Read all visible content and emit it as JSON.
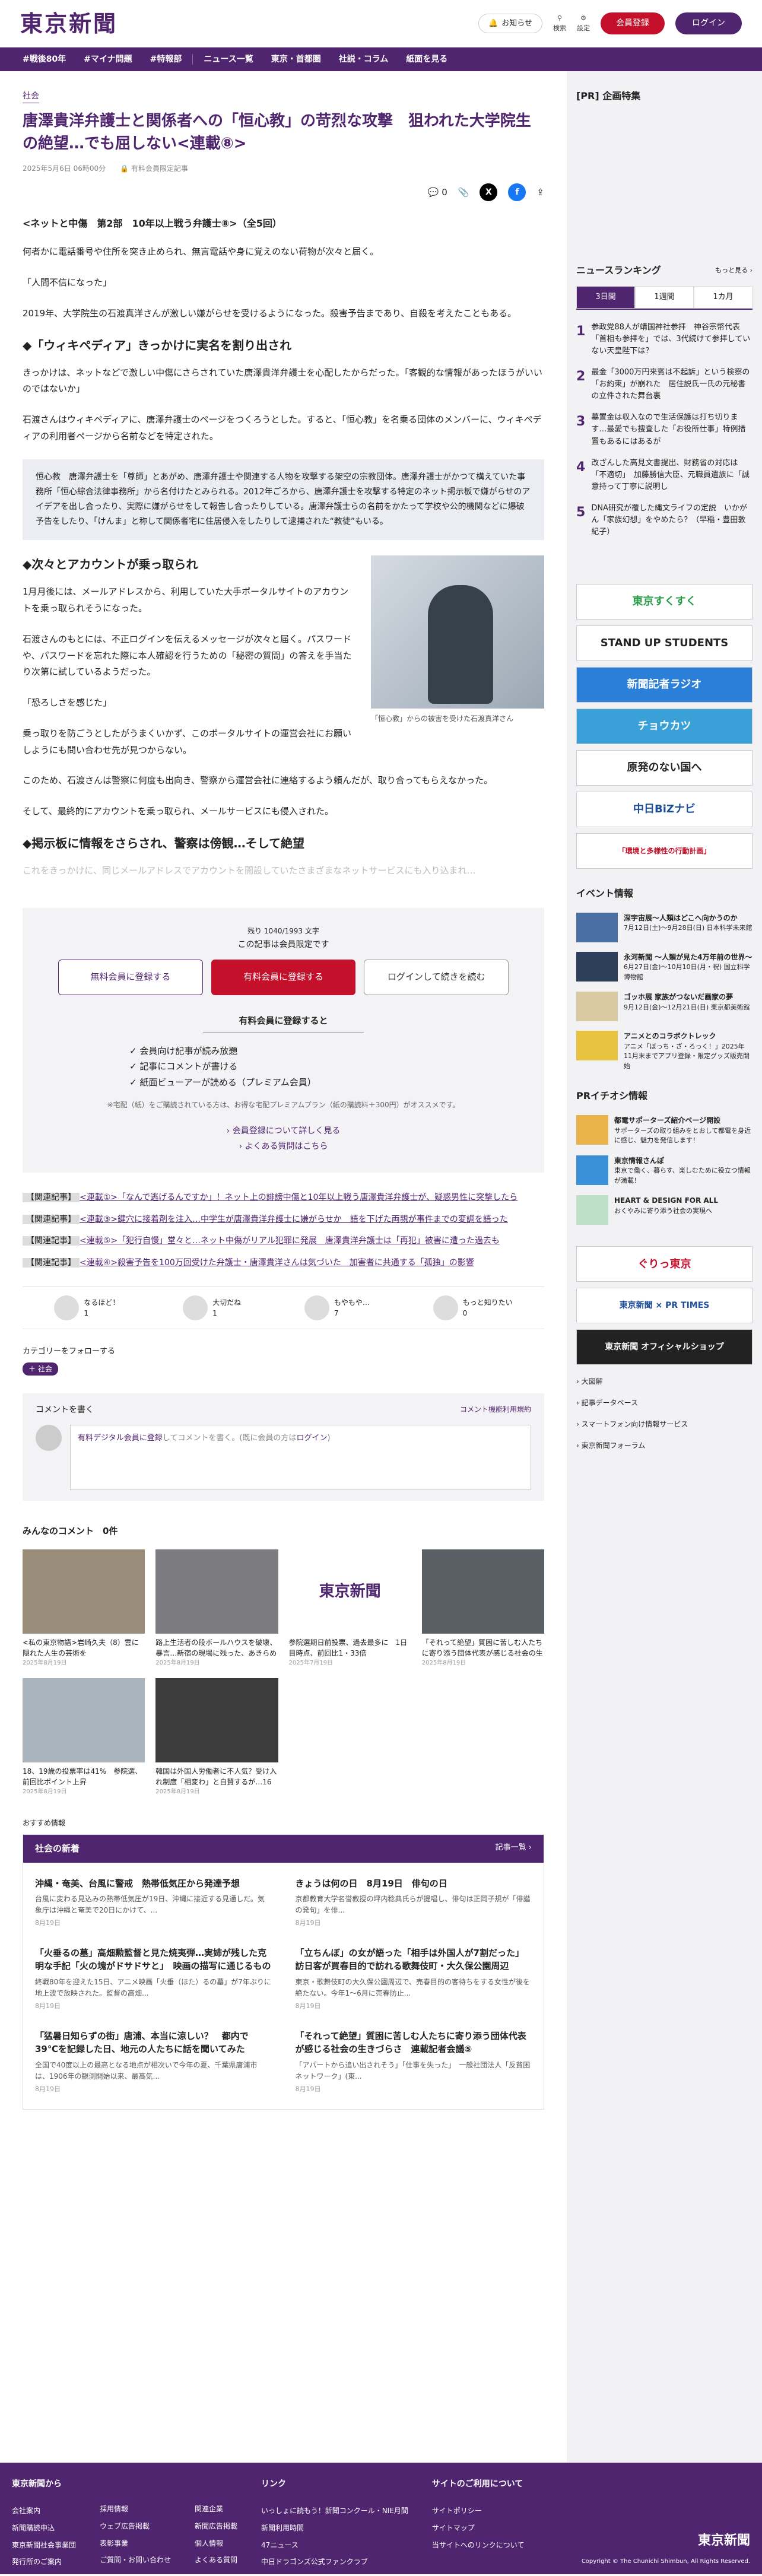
{
  "header": {
    "logo": "東京新聞",
    "notice": "お知らせ",
    "search": "検索",
    "settings": "設定",
    "register": "会員登録",
    "login": "ログイン"
  },
  "nav": {
    "items": [
      "#戦後80年",
      "#マイナ問題",
      "#特報部",
      "ニュース一覧",
      "東京・首都圏",
      "社説・コラム",
      "紙面を見る"
    ]
  },
  "article": {
    "category": "社会",
    "title": "唐澤貴洋弁護士と関係者への「恒心教」の苛烈な攻撃　狙われた大学院生の絶望…でも屈しない<連載⑧>",
    "date": "2025年5月6日 06時00分",
    "badge": "有料会員限定記事",
    "comment_count": "0",
    "series": "<ネットと中傷　第2部　10年以上戦う弁護士⑧>（全5回）",
    "paras": [
      "何者かに電話番号や住所を突き止められ、無言電話や身に覚えのない荷物が次々と届く。",
      "「人間不信になった」",
      "2019年、大学院生の石渡真洋さんが激しい嫌がらせを受けるようになった。殺害予告まであり、自殺を考えたこともある。"
    ],
    "h1": "◆「ウィキペディア」きっかけに実名を割り出され",
    "paras2": [
      "きっかけは、ネットなどで激しい中傷にさらされていた唐澤貴洋弁護士を心配したからだった。「客観的な情報があったほうがいいのではないか」",
      "石渡さんはウィキペディアに、唐澤弁護士のページをつくろうとした。すると、「恒心教」を名乗る団体のメンバーに、ウィキペディアの利用者ページから名前などを特定された。"
    ],
    "note": "恒心教　唐澤弁護士を「尊師」とあがめ、唐澤弁護士や関連する人物を攻撃する架空の宗教団体。唐澤弁護士がかつて構えていた事務所「恒心綜合法律事務所」から名付けたとみられる。2012年ごろから、唐澤弁護士を攻撃する特定のネット掲示板で嫌がらせのアイデアを出し合ったり、実際に嫌がらせをして報告し合ったりしている。唐澤弁護士らの名前をかたって学校や公的機関などに爆破予告をしたり、「けんま」と称して関係者宅に住居侵入をしたりして逮捕された“教徒”もいる。",
    "h2": "◆次々とアカウントが乗っ取られ",
    "paras3": [
      "1月月後には、メールアドレスから、利用していた大手ポータルサイトのアカウントを乗っ取られそうになった。",
      "石渡さんのもとには、不正ログインを伝えるメッセージが次々と届く。パスワードや、パスワードを忘れた際に本人確認を行うための「秘密の質問」の答えを手当たり次第に試しているようだった。",
      "「恐ろしさを感じた」",
      "乗っ取りを防ごうとしたがうまくいかず、このポータルサイトの運営会社にお願いしようにも問い合わせ先が見つからない。",
      "このため、石渡さんは警察に何度も出向き、警察から運営会社に連絡するよう頼んだが、取り合ってもらえなかった。",
      "そして、最終的にアカウントを乗っ取られ、メールサービスにも侵入された。"
    ],
    "caption": "「恒心教」からの被害を受けた石渡真洋さん",
    "h3": "◆掲示板に情報をさらされ、警察は傍観…そして絶望",
    "fade": "これをきっかけに、同じメールアドレスでアカウントを開設していたさまざまなネットサービスにも入り込まれ…"
  },
  "paywall": {
    "count": "残り 1040/1993 文字",
    "title": "この記事は会員限定です",
    "b1": "無料会員に登録する",
    "b2": "有料会員に登録する",
    "b3": "ログインして続きを読む",
    "head": "有料会員に登録すると",
    "list": [
      "✓ 会員向け記事が読み放題",
      "✓ 記事にコメントが書ける",
      "✓ 紙面ビューアーが読める（プレミアム会員）"
    ],
    "small": "※宅配（紙）をご購読されている方は、お得な宅配プレミアムプラン（紙の購読料＋300円）がオススメです。",
    "l1": "› 会員登録について詳しく見る",
    "l2": "› よくある質問はこちら"
  },
  "related": [
    {
      "tag": "【関連記事】",
      "text": "<連載①>「なんで逃げるんですか」！ネット上の誹謗中傷と10年以上戦う唐澤貴洋弁護士が、疑惑男性に突撃したら"
    },
    {
      "tag": "【関連記事】",
      "text": "<連載③>鍵穴に接着剤を注入…中学生が唐澤貴洋弁護士に嫌がらせか　語を下げた両親が事件までの変調を語った"
    },
    {
      "tag": "【関連記事】",
      "text": "<連載⑤>「犯行自慢」堂々と…ネット中傷がリアル犯罪に発展　唐澤貴洋弁護士は「再犯」被害に遭った過去も"
    },
    {
      "tag": "【関連記事】",
      "text": "<連載④>殺害予告を100万回受けた弁護士・唐澤貴洋さんは気づいた　加害者に共通する「孤独」の影響"
    }
  ],
  "reactions": [
    {
      "label": "なるほど！",
      "count": "1"
    },
    {
      "label": "大切だね",
      "count": "1"
    },
    {
      "label": "もやもや…",
      "count": "7"
    },
    {
      "label": "もっと知りたい",
      "count": "0"
    }
  ],
  "follow": {
    "label": "カテゴリーをフォローする",
    "tag": "＋ 社会"
  },
  "comment": {
    "title": "コメントを書く",
    "link": "コメント機能利用規約",
    "pre": "有料デジタル会員に登録",
    "mid": "してコメントを書く。(既に会員の方は",
    "login": "ログイン",
    "post": ")"
  },
  "all_comments": "みんなのコメント　0件",
  "cards": [
    {
      "t": "<私の東京物語>岩崎久夫（8）雲に隠れた人生の芸術を",
      "d": "2025年8月19日"
    },
    {
      "t": "路上生活者の段ボールハウスを破壊、暴言…新宿の現場に残った、あきらめの声「やり...",
      "d": "2025年8月19日"
    },
    {
      "t": "参院選期日前投票、過去最多に　1日目時点、前回比1・33倍",
      "d": "2025年7月19日"
    },
    {
      "t": "「それって絶望」質困に苦しむ人たちに寄り添う団体代表が感じる社会の生きづらさ　連載...",
      "d": "2025年8月19日"
    },
    {
      "t": "18、19歳の投票率は41%　参院選、前回比ポイント上昇",
      "d": "2025年8月19日"
    },
    {
      "t": "韓国は外国人労働者に不人気？受け入れ制度「相変わ」と自賛するが…16万5000人の仲介手...",
      "d": "2025年8月19日"
    }
  ],
  "recommend": "おすすめ情報",
  "news": {
    "title": "社会の新着",
    "more": "記事一覧 ›",
    "items": [
      {
        "t": "沖縄・奄美、台風に警戒　熱帯低気圧から発達予想",
        "s": "台風に変わる見込みの熱帯低気圧が19日、沖縄に接近する見通しだ。気象庁は沖縄と奄美で20日にかけて、...",
        "d": "8月19日"
      },
      {
        "t": "きょうは何の日　8月19日　俳句の日",
        "s": "京都教育大学名誉教授の坪内稔典氏らが提唱し、俳句は正岡子規が「俳諧の発句」を俳...",
        "d": "8月19日"
      },
      {
        "t": "「火垂るの墓」高畑勲監督と見た焼夷弾…実姉が残した克明な手記「火の塊がドサドサと」　映画の描写に通じるもの",
        "s": "終戦80年を迎えた15日、アニメ映画「火垂（ほた）るの墓」が7年ぶりに地上波で放映された。監督の高畑...",
        "d": "8月19日"
      },
      {
        "t": "「立ちんぼ」の女が語った「相手は外国人が7割だった」訪日客が買春目的で訪れる歌舞伎町・大久保公園周辺",
        "s": "東京・歌舞伎町の大久保公園周辺で、売春目的の客待ちをする女性が後を絶たない。今年1〜6月に売春防止...",
        "d": "8月19日"
      },
      {
        "t": "「猛暑日知らずの街」唐浦、本当に涼しい？　都内で39℃を記録した日、地元の人たちに話を聞いてみた",
        "s": "全国で40度以上の最高となる地点が相次いで今年の夏、千葉県唐浦市は、1906年の観測開始以来、最高気...",
        "d": "8月19日"
      },
      {
        "t": "「それって絶望」質困に苦しむ人たちに寄り添う団体代表が感じる社会の生きづらさ　連載記者会議⑤",
        "s": "「アパートから追い出されそう」「仕事を失った」　一般社団法人「反貧困ネットワーク」(東...",
        "d": "8月19日"
      }
    ]
  },
  "side": {
    "pr": "[PR] 企画特集",
    "ranking": "ニュースランキング",
    "more": "もっと見る ›",
    "tabs": [
      "3日間",
      "1週間",
      "1カ月"
    ],
    "ranks": [
      "参政党88人が靖国神社参拝　神谷宗幣代表「首相も参拝を」では、3代続けて参拝していない天皇陛下は？",
      "最金「3000万円来賓は不起訴」という検察の「お約束」が崩れた　居住説氏一氏の元秘書の立件された舞台裏",
      "墓置金は収入なので生活保護は打ち切ります…最愛でも捜査した「お役所仕事」特例措置もあるにはあるが",
      "改ざんした高見文書提出、財務省の対応は「不適切」　加藤勝信大臣、元職員遺族に「誠意持って丁寧に説明し",
      "DNA研究が覆した縄文ライフの定説　いかがん「家族幻想」をやめたら？（早稲・豊田敦紀子）"
    ],
    "banners": [
      "東京すくすく",
      "STAND UP STUDENTS",
      "新聞記者ラジオ",
      "チョウカツ",
      "原発のない国へ",
      "中日BiZナビ",
      "「環境と多様性の行動計画」"
    ],
    "events_title": "イベント情報",
    "events": [
      {
        "t": "深宇宙展〜人類はどこへ向かうのか",
        "s": "7月12日(土)〜9月28日(日) 日本科学未来館"
      },
      {
        "t": "永河新聞 〜人類が見た4万年前の世界〜",
        "s": "6月27日(金)〜10月10日(月・祝) 国立科学博物館"
      },
      {
        "t": "ゴッホ展 家族がつないだ画家の夢",
        "s": "9月12日(金)〜12月21日(日) 東京都美術館"
      },
      {
        "t": "アニメとのコラボクトレック",
        "s": "アニメ「ぼっち・ざ・ろっく！」2025年11月末までアプリ登録・限定グッズ販売開始"
      }
    ],
    "prichi": "PRイチオシ情報",
    "pr_items": [
      {
        "t": "都電サポーターズ紹介ページ開設",
        "s": "サポーターズの取り組みをとおして都電を身近に感じ、魅力を発信します！"
      },
      {
        "t": "東京情報さんぽ",
        "s": "東京で働く、暮らす、楽しむために役立つ情報が満載！"
      },
      {
        "t": "HEART & DESIGN FOR ALL",
        "s": "おくやみに寄り添う社会の実現へ"
      }
    ],
    "ads": [
      "ぐりっ東京",
      "東京新聞 × PR TIMES",
      "東京新聞 オフィシャルショップ"
    ],
    "links": [
      "› 大図解",
      "› 記事データベース",
      "› スマートフォン向け情報サービス",
      "› 東京新聞フォーラム"
    ]
  },
  "footer": {
    "c1": "東京新聞から",
    "c1items": [
      "会社案内",
      "新聞購読申込",
      "東京新聞社会事業団",
      "発行所のご案内"
    ],
    "c2items": [
      "採用情報",
      "ウェブ広告掲載",
      "表彰事業",
      "ご質問・お問い合わせ"
    ],
    "c3items": [
      "関連企業",
      "新聞広告掲載",
      "個人情報",
      "よくある質問"
    ],
    "c4": "リンク",
    "c4items": [
      "いっしょに読もう！新聞コンクール・NIE月間",
      "新聞利用時間",
      "47ニュース",
      "中日ドラゴンズ公式ファンクラブ"
    ],
    "c5": "サイトのご利用について",
    "c5items": [
      "サイトポリシー",
      "サイトマップ",
      "当サイトへのリンクについて"
    ],
    "logo": "東京新聞",
    "copy": "Copyright © The Chunichi Shimbun, All Rights Reserved."
  }
}
